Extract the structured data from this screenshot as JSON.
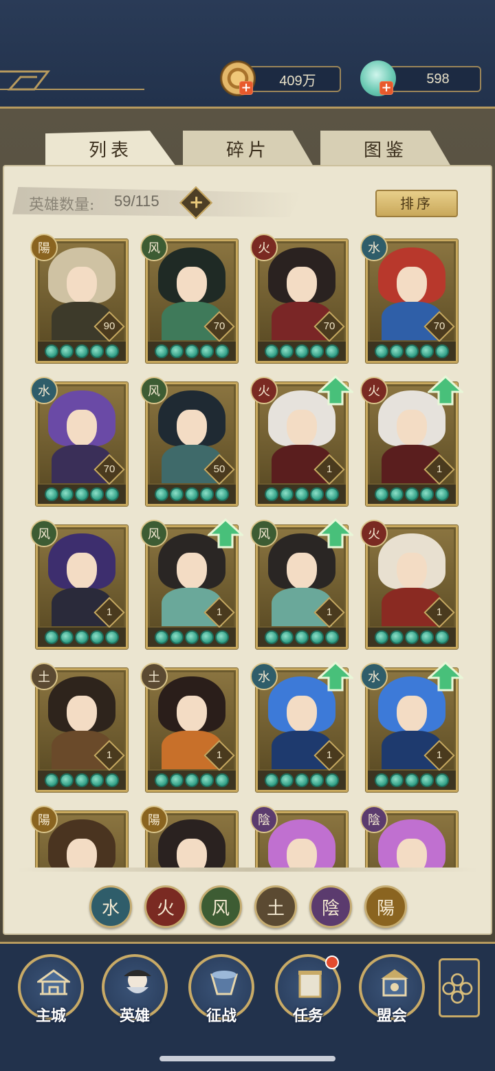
{
  "header": {
    "coins": "409万",
    "gems": "598"
  },
  "tabs": [
    {
      "label": "列表",
      "active": true
    },
    {
      "label": "碎片",
      "active": false
    },
    {
      "label": "图鉴",
      "active": false
    }
  ],
  "hero_count": {
    "label": "英雄数量:",
    "value": "59/115"
  },
  "sort_label": "排序",
  "elements": {
    "water": {
      "glyph": "水",
      "color": "#2f5d6a"
    },
    "fire": {
      "glyph": "火",
      "color": "#7a2a22"
    },
    "wind": {
      "glyph": "风",
      "color": "#3d5c33"
    },
    "earth": {
      "glyph": "土",
      "color": "#5b4a32"
    },
    "yin": {
      "glyph": "陰",
      "color": "#5b3b6e"
    },
    "yang": {
      "glyph": "陽",
      "color": "#8a6420"
    }
  },
  "heroes": [
    {
      "element": "yang",
      "level": "90",
      "upgrade": false
    },
    {
      "element": "wind",
      "level": "70",
      "upgrade": false
    },
    {
      "element": "fire",
      "level": "70",
      "upgrade": false
    },
    {
      "element": "water",
      "level": "70",
      "upgrade": false
    },
    {
      "element": "water",
      "level": "70",
      "upgrade": false
    },
    {
      "element": "wind",
      "level": "50",
      "upgrade": false
    },
    {
      "element": "fire",
      "level": "1",
      "upgrade": true
    },
    {
      "element": "fire",
      "level": "1",
      "upgrade": true
    },
    {
      "element": "wind",
      "level": "1",
      "upgrade": false
    },
    {
      "element": "wind",
      "level": "1",
      "upgrade": true
    },
    {
      "element": "wind",
      "level": "1",
      "upgrade": true
    },
    {
      "element": "fire",
      "level": "1",
      "upgrade": false
    },
    {
      "element": "earth",
      "level": "1",
      "upgrade": false
    },
    {
      "element": "earth",
      "level": "1",
      "upgrade": false
    },
    {
      "element": "water",
      "level": "1",
      "upgrade": true
    },
    {
      "element": "water",
      "level": "1",
      "upgrade": true
    },
    {
      "element": "yang",
      "level": "",
      "upgrade": false
    },
    {
      "element": "yang",
      "level": "",
      "upgrade": false
    },
    {
      "element": "yin",
      "level": "",
      "upgrade": false
    },
    {
      "element": "yin",
      "level": "",
      "upgrade": false
    }
  ],
  "filters": [
    "water",
    "fire",
    "wind",
    "earth",
    "yin",
    "yang"
  ],
  "nav": [
    {
      "id": "main-city",
      "label": "主城"
    },
    {
      "id": "heroes",
      "label": "英雄"
    },
    {
      "id": "battle",
      "label": "征战"
    },
    {
      "id": "tasks",
      "label": "任务",
      "badge": true
    },
    {
      "id": "alliance",
      "label": "盟会"
    }
  ]
}
